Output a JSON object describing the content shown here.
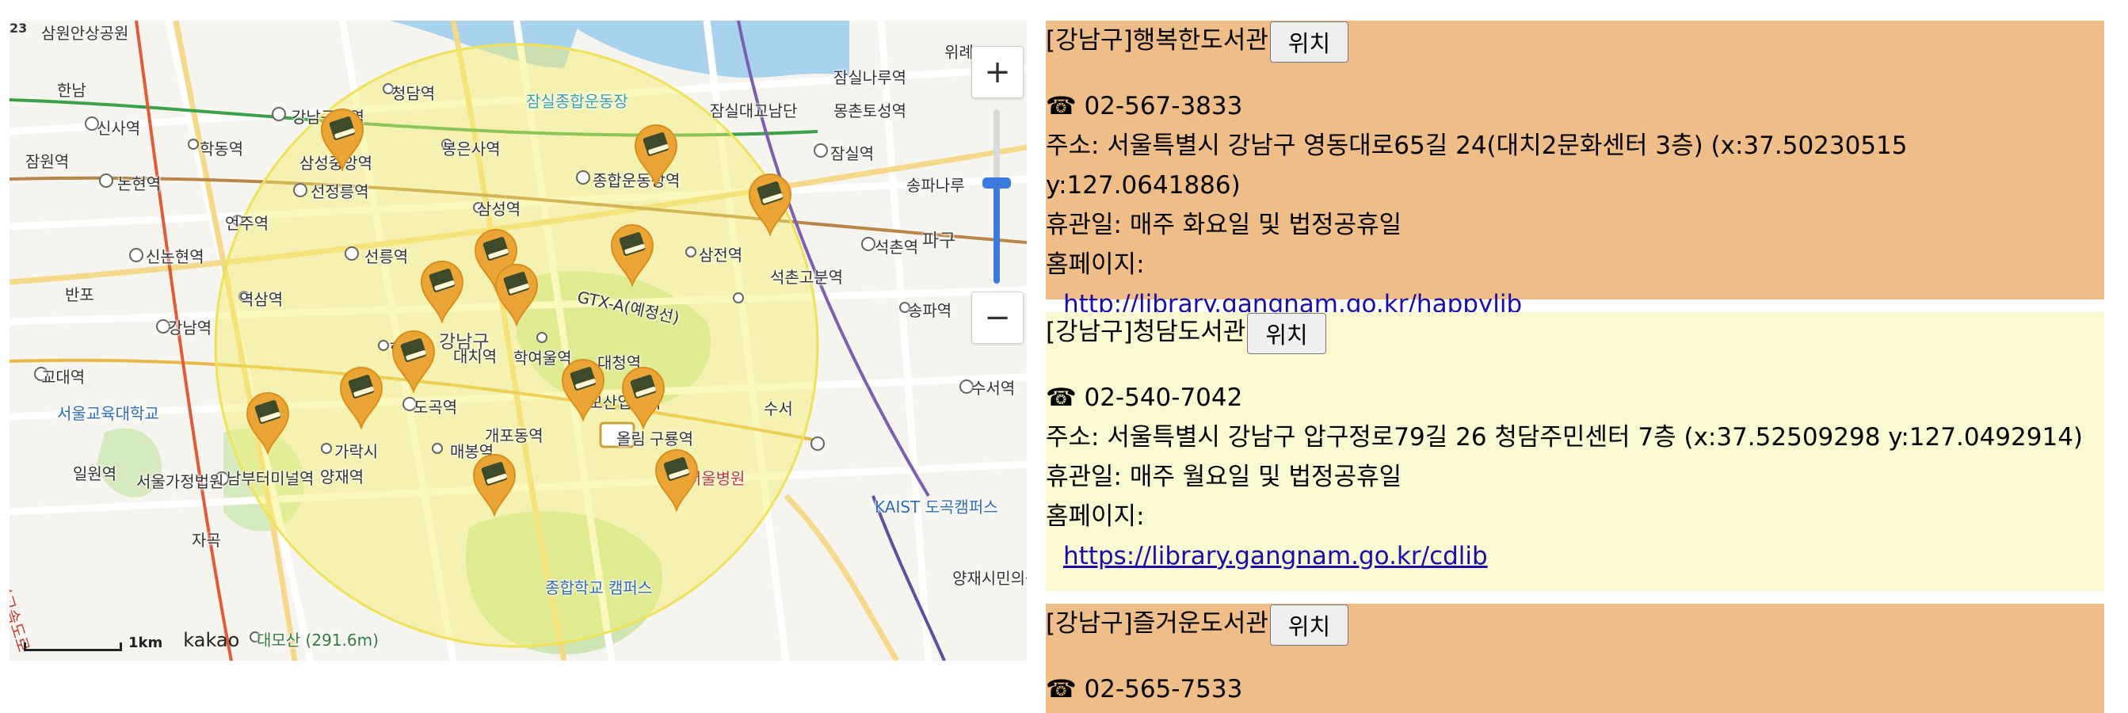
{
  "map": {
    "zoom_in_label": "+",
    "zoom_out_label": "−",
    "scale_label": "1km",
    "logo": "kakao",
    "labels": [
      {
        "text": "삼원안상공원",
        "cls": ""
      },
      {
        "text": "한남",
        "cls": ""
      },
      {
        "text": "신사역",
        "cls": ""
      },
      {
        "text": "잠원역",
        "cls": ""
      },
      {
        "text": "논현역",
        "cls": ""
      },
      {
        "text": "학동역",
        "cls": ""
      },
      {
        "text": "강남구청역",
        "cls": ""
      },
      {
        "text": "청담역",
        "cls": ""
      },
      {
        "text": "봉은사역",
        "cls": ""
      },
      {
        "text": "잠실종합운동장",
        "cls": "teal"
      },
      {
        "text": "종합운동장역",
        "cls": ""
      },
      {
        "text": "잠실나루역",
        "cls": ""
      },
      {
        "text": "몽촌토성역",
        "cls": ""
      },
      {
        "text": "잠실대교남단",
        "cls": ""
      },
      {
        "text": "잠실역",
        "cls": ""
      },
      {
        "text": "송파나루",
        "cls": ""
      },
      {
        "text": "석촌역",
        "cls": ""
      },
      {
        "text": "파구",
        "cls": "big"
      },
      {
        "text": "삼성중앙역",
        "cls": ""
      },
      {
        "text": "선정릉역",
        "cls": ""
      },
      {
        "text": "언주역",
        "cls": ""
      },
      {
        "text": "삼성역",
        "cls": ""
      },
      {
        "text": "신논현역",
        "cls": ""
      },
      {
        "text": "선릉역",
        "cls": ""
      },
      {
        "text": "삼전역",
        "cls": ""
      },
      {
        "text": "석촌고분역",
        "cls": ""
      },
      {
        "text": "송파역",
        "cls": ""
      },
      {
        "text": "역삼역",
        "cls": ""
      },
      {
        "text": "반포",
        "cls": ""
      },
      {
        "text": "강남역",
        "cls": ""
      },
      {
        "text": "GTX-A(예정선)",
        "cls": ""
      },
      {
        "text": "한티역",
        "cls": ""
      },
      {
        "text": "강남구",
        "cls": "big"
      },
      {
        "text": "대치역",
        "cls": ""
      },
      {
        "text": "학여울역",
        "cls": ""
      },
      {
        "text": "대청역",
        "cls": ""
      },
      {
        "text": "교대역",
        "cls": ""
      },
      {
        "text": "서울교육대학교",
        "cls": "blue"
      },
      {
        "text": "도곡역",
        "cls": ""
      },
      {
        "text": "개포동역",
        "cls": ""
      },
      {
        "text": "대모산입구역",
        "cls": ""
      },
      {
        "text": "수서",
        "cls": ""
      },
      {
        "text": "수서역",
        "cls": ""
      },
      {
        "text": "가락시",
        "cls": ""
      },
      {
        "text": "매봉역",
        "cls": ""
      },
      {
        "text": "구룡역",
        "cls": ""
      },
      {
        "text": "삼성서울병원",
        "cls": "red"
      },
      {
        "text": "일원역",
        "cls": ""
      },
      {
        "text": "남부터미널역",
        "cls": ""
      },
      {
        "text": "양재역",
        "cls": ""
      },
      {
        "text": "KAIST 도곡캠퍼스",
        "cls": "blue"
      },
      {
        "text": "자곡",
        "cls": ""
      },
      {
        "text": "서울가정법원",
        "cls": ""
      },
      {
        "text": "경부고속도로",
        "cls": "red"
      },
      {
        "text": "종합학교 캠퍼스",
        "cls": "blue"
      },
      {
        "text": "대모산 (291.6m)",
        "cls": "green"
      },
      {
        "text": "양재시민의숲역",
        "cls": ""
      },
      {
        "text": "위례",
        "cls": ""
      },
      {
        "text": "올림",
        "cls": ""
      },
      {
        "text": "23",
        "cls": ""
      }
    ],
    "marker_count": 14
  },
  "libraries": [
    {
      "name": "[강남구]행복한도서관",
      "button": "위치",
      "phone": "☎ 02-567-3833",
      "address": "주소: 서울특별시 강남구 영동대로65길 24(대치2문화센터 3층) (x:37.50230515  y:127.0641886)",
      "closed": "휴관일: 매주 화요일 및 법정공휴일",
      "homepage_label": "홈페이지:",
      "homepage_url": "http://library.gangnam.go.kr/happylib",
      "bg": "#efbd87"
    },
    {
      "name": "[강남구]청담도서관",
      "button": "위치",
      "phone": "☎ 02-540-7042",
      "address": "주소: 서울특별시 강남구 압구정로79길 26 청담주민센터 7층 (x:37.52509298  y:127.0492914)",
      "closed": "휴관일: 매주 월요일 및 법정공휴일",
      "homepage_label": "홈페이지:",
      "homepage_url": "https://library.gangnam.go.kr/cdlib",
      "bg": "#fbf9d1"
    },
    {
      "name": "[강남구]즐거운도서관",
      "button": "위치",
      "phone": "☎ 02-565-7533",
      "bg": "#efbd87"
    }
  ]
}
